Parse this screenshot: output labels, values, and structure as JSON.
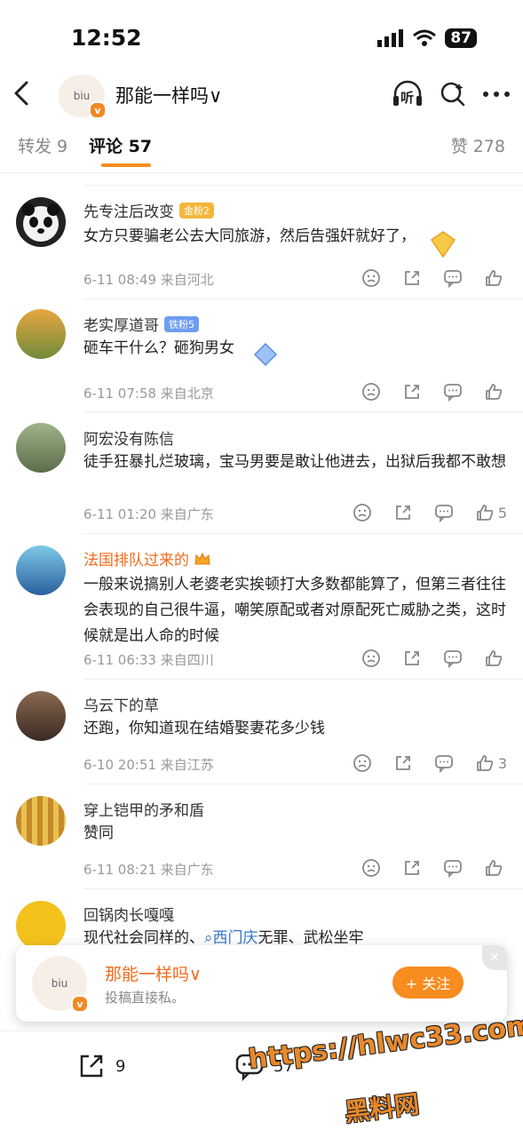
{
  "status_bar": {
    "time": "12:52",
    "battery": "87"
  },
  "header": {
    "avatar_text": "biu",
    "title": "那能一样吗∨",
    "listen_label": "听"
  },
  "tabs": {
    "repost": "转发 9",
    "comments": "评论 57",
    "likes": "赞 278"
  },
  "comments": [
    {
      "name": "先专注后改变",
      "badge": "金粉2",
      "badge_color": "#f5b63a",
      "text": "女方只要骗老公去大同旅游，然后告强奸就好了，",
      "meta": "6-11 08:49 来自河北",
      "like_count": ""
    },
    {
      "name": "老实厚道哥",
      "badge": "铁粉5",
      "badge_color": "#6e9cf0",
      "text": "砸车干什么？砸狗男女",
      "meta": "6-11 07:58 来自北京",
      "like_count": ""
    },
    {
      "name": "阿宏没有陈信",
      "badge": "",
      "badge_color": "",
      "text": "徒手狂暴扎烂玻璃，宝马男要是敢让他进去，出狱后我都不敢想",
      "meta": "6-11 01:20 来自广东",
      "like_count": "5"
    },
    {
      "name": "法国排队过来的",
      "badge": "",
      "badge_color": "",
      "text": "一般来说搞别人老婆老实挨顿打大多数都能算了，但第三者往往会表现的自己很牛逼，嘲笑原配或者对原配死亡威胁之类，这时候就是出人命的时候",
      "meta": "6-11 06:33 来自四川",
      "like_count": ""
    },
    {
      "name": "乌云下的草",
      "badge": "",
      "badge_color": "",
      "text": "还跑，你知道现在结婚娶妻花多少钱",
      "meta": "6-10 20:51 来自江苏",
      "like_count": "3"
    },
    {
      "name": "穿上铠甲的矛和盾",
      "badge": "",
      "badge_color": "",
      "text": "赞同",
      "meta": "6-11 08:21 来自广东",
      "like_count": ""
    },
    {
      "name": "回锅肉长嘎嘎",
      "badge": "",
      "badge_color": "",
      "text_prefix": "现代社会同样的、",
      "topic": "西门庆",
      "text_suffix": "无罪、武松坐牢",
      "meta": "",
      "like_count": ""
    }
  ],
  "popup": {
    "avatar_text": "biu",
    "name": "那能一样吗∨",
    "desc": "投稿直接私。",
    "follow": "+ 关注"
  },
  "bottom_bar": {
    "repost_count": "9",
    "comment_count": "57"
  },
  "watermark": {
    "line1": "https://hlwc33.com",
    "line2": "黑料网"
  },
  "colors": {
    "accent": "#f78c1f",
    "name_vip": "#f06c1b",
    "topic": "#3573c9"
  }
}
